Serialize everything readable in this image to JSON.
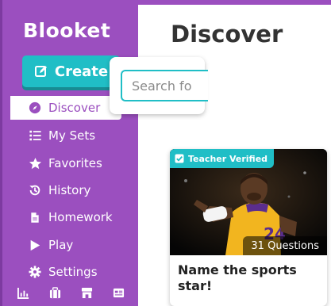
{
  "sidebar": {
    "logo": "Blooket",
    "create_label": "Create",
    "items": [
      {
        "label": "Discover",
        "icon": "compass-icon",
        "active": true
      },
      {
        "label": "My Sets",
        "icon": "list-icon"
      },
      {
        "label": "Favorites",
        "icon": "star-icon"
      },
      {
        "label": "History",
        "icon": "history-icon"
      },
      {
        "label": "Homework",
        "icon": "document-icon"
      },
      {
        "label": "Play",
        "icon": "play-icon"
      },
      {
        "label": "Settings",
        "icon": "gear-icon"
      }
    ],
    "bottom_icons": [
      "chart-icon",
      "briefcase-icon",
      "store-icon",
      "news-icon"
    ]
  },
  "main": {
    "title": "Discover",
    "search": {
      "placeholder": "Search fo"
    },
    "card": {
      "badge": "Teacher Verified",
      "question_count": "31 Questions",
      "title": "Name the sports star!"
    }
  },
  "colors": {
    "sidebar": "#9b4fbf",
    "accent": "#20bec6",
    "text_dark": "#333333"
  }
}
